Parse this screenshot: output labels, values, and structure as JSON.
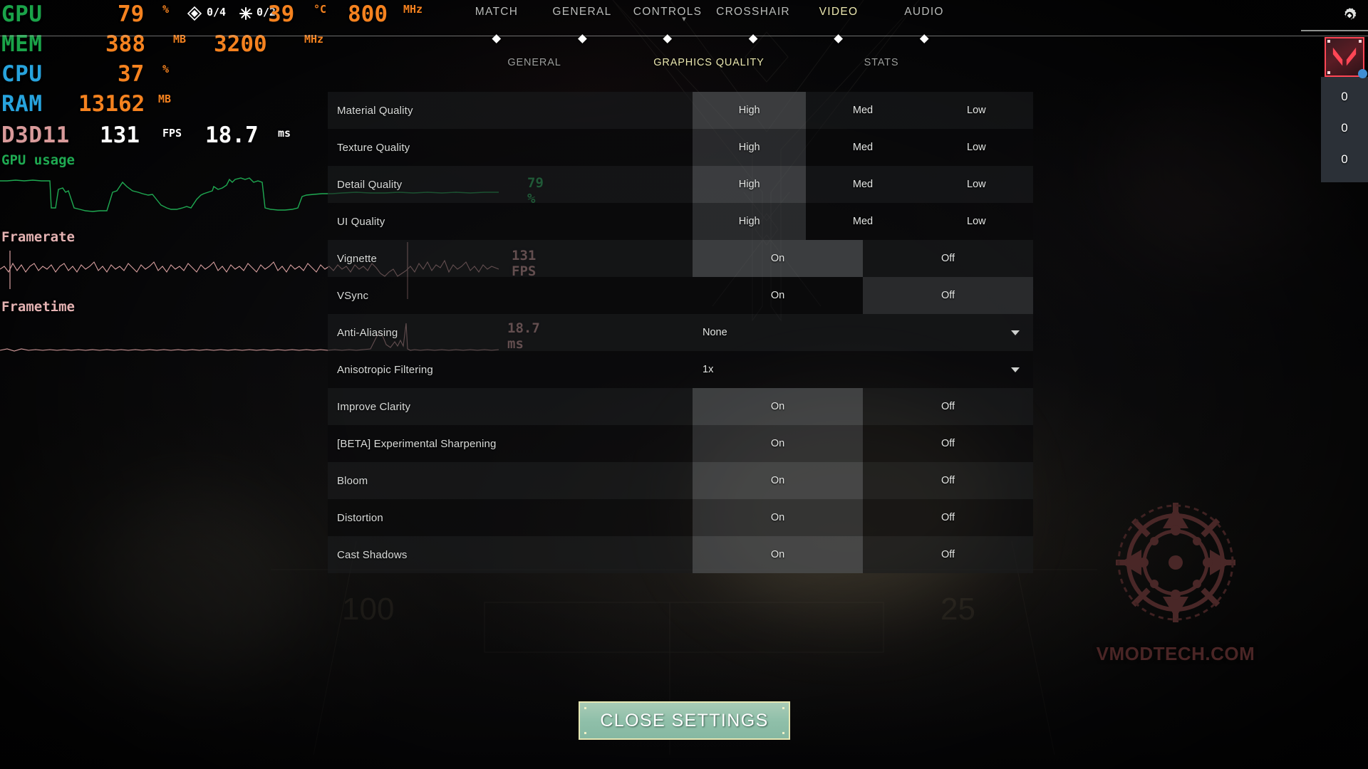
{
  "osd": {
    "rows": [
      {
        "key": "GPU",
        "key_color": "#1aa349",
        "value": "79",
        "unit": "%"
      },
      {
        "key": "MEM",
        "key_color": "#1aa349",
        "value": "388",
        "unit": "MB"
      },
      {
        "key": "CPU",
        "key_color": "#27a3dd",
        "value": "37",
        "unit": "%"
      },
      {
        "key": "RAM",
        "key_color": "#27a3dd",
        "value": "13162",
        "unit": "MB"
      },
      {
        "key": "D3D11",
        "key_color": "#d89a9a",
        "value": "131",
        "unit": "FPS"
      }
    ],
    "gpu_temp": "39",
    "gpu_temp_unit": "°C",
    "gpu_clock": "800",
    "gpu_clock_unit": "MHz",
    "mem_clock": "3200",
    "mem_clock_unit": "MHz",
    "frametime": "18.7",
    "frametime_unit": "ms",
    "fan_badge": "0/4",
    "fan_badge_2": "0/2",
    "graphs": [
      {
        "title": "GPU usage",
        "value": "79 %",
        "color": "#2bbd62"
      },
      {
        "title": "Framerate",
        "value": "131 FPS",
        "color": "#d9a0a0"
      },
      {
        "title": "Frametime",
        "value": "18.7 ms",
        "color": "#d9a0a0"
      }
    ]
  },
  "nav": {
    "items": [
      {
        "label": "MATCH",
        "active": false
      },
      {
        "label": "GENERAL",
        "active": false
      },
      {
        "label": "CONTROLS",
        "active": false
      },
      {
        "label": "CROSSHAIR",
        "active": false
      },
      {
        "label": "VIDEO",
        "active": true
      },
      {
        "label": "AUDIO",
        "active": false
      }
    ]
  },
  "subtabs": {
    "items": [
      {
        "label": "GENERAL",
        "active": false
      },
      {
        "label": "GRAPHICS QUALITY",
        "active": true
      },
      {
        "label": "STATS",
        "active": false
      }
    ]
  },
  "settings": {
    "rows": [
      {
        "label": "Material Quality",
        "type": "segment",
        "options": [
          "High",
          "Med",
          "Low"
        ],
        "selected": "High"
      },
      {
        "label": "Texture Quality",
        "type": "segment",
        "options": [
          "High",
          "Med",
          "Low"
        ],
        "selected": "High"
      },
      {
        "label": "Detail Quality",
        "type": "segment",
        "options": [
          "High",
          "Med",
          "Low"
        ],
        "selected": "High"
      },
      {
        "label": "UI Quality",
        "type": "segment",
        "options": [
          "High",
          "Med",
          "Low"
        ],
        "selected": "High"
      },
      {
        "label": "Vignette",
        "type": "segment",
        "options": [
          "On",
          "Off"
        ],
        "selected": "On"
      },
      {
        "label": "VSync",
        "type": "segment",
        "options": [
          "On",
          "Off"
        ],
        "selected": "Off"
      },
      {
        "label": "Anti-Aliasing",
        "type": "dropdown",
        "value": "None"
      },
      {
        "label": "Anisotropic Filtering",
        "type": "dropdown",
        "value": "1x"
      },
      {
        "label": "Improve Clarity",
        "type": "segment",
        "options": [
          "On",
          "Off"
        ],
        "selected": "On"
      },
      {
        "label": "[BETA] Experimental Sharpening",
        "type": "segment",
        "options": [
          "On",
          "Off"
        ],
        "selected": "On"
      },
      {
        "label": "Bloom",
        "type": "segment",
        "options": [
          "On",
          "Off"
        ],
        "selected": "On"
      },
      {
        "label": "Distortion",
        "type": "segment",
        "options": [
          "On",
          "Off"
        ],
        "selected": "On"
      },
      {
        "label": "Cast Shadows",
        "type": "segment",
        "options": [
          "On",
          "Off"
        ],
        "selected": "On"
      }
    ]
  },
  "close_button": {
    "label": "CLOSE SETTINGS"
  },
  "hud": {
    "stats": [
      "0",
      "0",
      "0"
    ],
    "thumb_icon": "valorant-logo-icon",
    "gear_icon": "gear-icon"
  },
  "watermark": {
    "text": "VMODTECH.COM"
  },
  "colors": {
    "osd_value": "#f5821f",
    "accent_yellow": "#e9e6ae",
    "close_button_fill": "#8fbfa9",
    "close_button_border": "#e6e7b4",
    "valorant_red": "#ff4655",
    "graph_green": "#2bbd62",
    "graph_pink": "#d9a0a0"
  }
}
